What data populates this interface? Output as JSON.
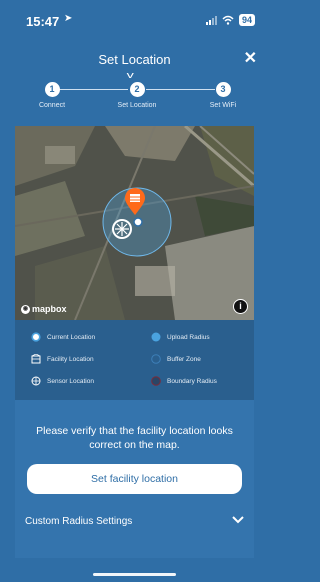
{
  "status": {
    "time": "15:47",
    "battery": "94"
  },
  "header": {
    "title": "Set Location"
  },
  "steps": [
    {
      "number": "1",
      "label": "Connect"
    },
    {
      "number": "2",
      "label": "Set Location"
    },
    {
      "number": "3",
      "label": "Set WiFi"
    }
  ],
  "map": {
    "attribution": "mapbox"
  },
  "legend": {
    "current_location": "Current Location",
    "upload_radius": "Upload Radius",
    "facility_location": "Facility Location",
    "buffer_zone": "Buffer Zone",
    "sensor_location": "Sensor Location",
    "boundary_radius": "Boundary Radius"
  },
  "panel": {
    "verify_text": "Please verify that the facility location looks correct on the map.",
    "set_button": "Set facility location",
    "custom_radius": "Custom Radius Settings"
  },
  "colors": {
    "background": "#2f6ea6",
    "legend_bg": "#2a5f8e",
    "upload_radius": "#4aa3e0",
    "buffer_zone": "#2a5f8e",
    "boundary_radius": "#7a2b3a",
    "facility_pin": "#ff6a1a"
  }
}
